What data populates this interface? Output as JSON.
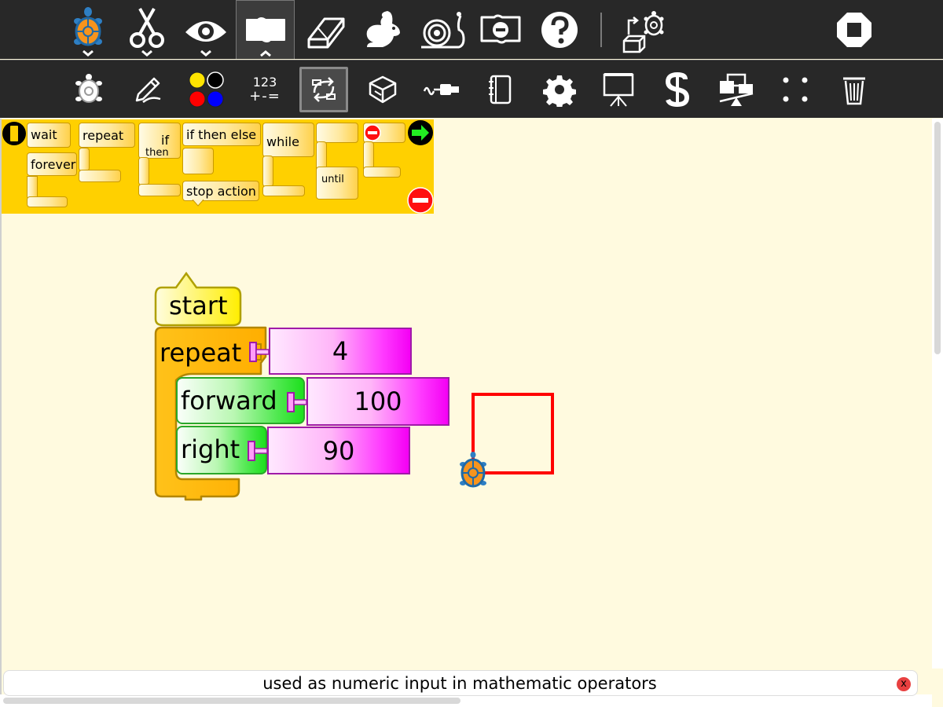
{
  "toolbar_main": {
    "buttons": [
      "turtle-activity-icon",
      "edit-scissors-icon",
      "view-eye-icon",
      "palette-toolbar-icon",
      "eraser-icon",
      "run-rabbit-icon",
      "step-snail-icon",
      "hide-blocks-icon",
      "help-icon",
      "load-example-icon",
      "stop-icon"
    ]
  },
  "toolbar_palettes": {
    "calc_line1": "123",
    "calc_line2": "+-=",
    "buttons": [
      "turtle-palette-icon",
      "pen-palette-icon",
      "colors-palette-icon",
      "numbers-palette-icon",
      "flow-palette-icon",
      "blocks-palette-icon",
      "sensors-palette-icon",
      "media-palette-icon",
      "extras-palette-icon",
      "presentation-palette-icon",
      "portfolio-palette-icon",
      "trash-palette-icon"
    ],
    "selected": "flow-palette-icon"
  },
  "flow_palette": {
    "wait": "wait",
    "forever": "forever",
    "repeat": "repeat",
    "if": "if",
    "then": "then",
    "if_then_else": "if then else",
    "stop_action": "stop action",
    "while": "while",
    "until": "until"
  },
  "program": {
    "start": "start",
    "repeat_label": "repeat",
    "repeat_count": "4",
    "forward_label": "forward",
    "forward_value": "100",
    "right_label": "right",
    "right_value": "90"
  },
  "turtle_drawing": {
    "pen_color": "#ff0000",
    "shape": "square"
  },
  "colors": {
    "toolbar": "#282828",
    "canvas": "#fffadf",
    "flow_palette": "#ffd000",
    "number_block": "#ff00ff",
    "motion_block": "#22e022"
  },
  "status": {
    "help_text": "used as numeric input in mathematic operators",
    "close": "x"
  }
}
